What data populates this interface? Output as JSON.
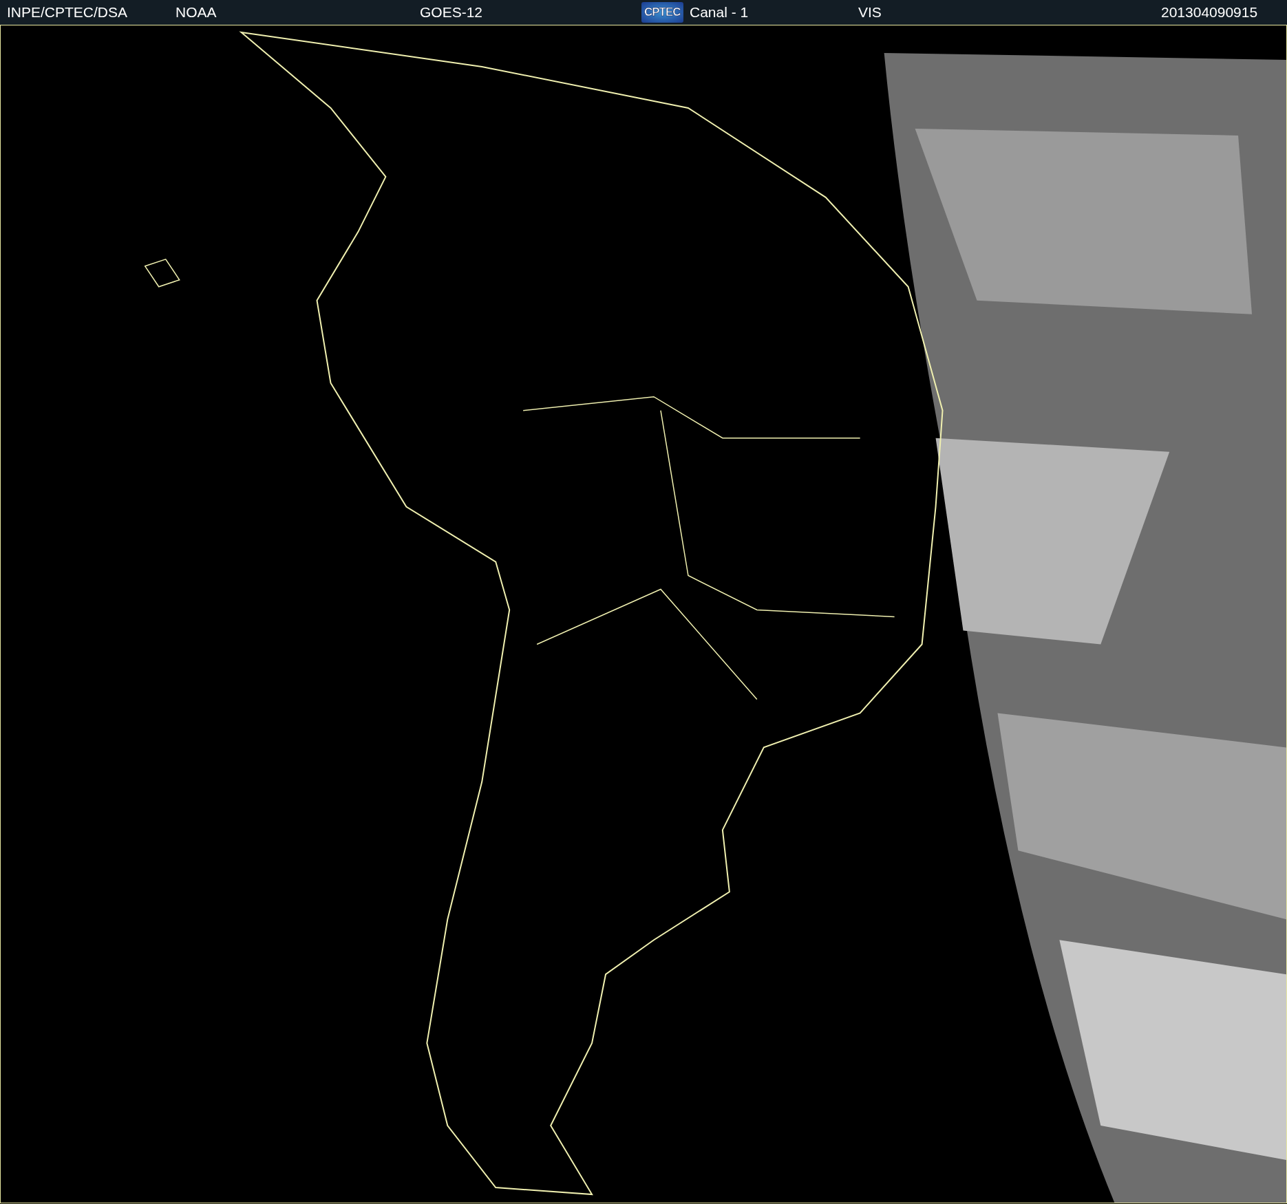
{
  "header": {
    "items": [
      {
        "kind": "text",
        "text": "INPE/CPTEC/DSA"
      },
      {
        "kind": "text",
        "text": "NOAA"
      },
      {
        "kind": "text",
        "text": "GOES-12"
      },
      {
        "kind": "logo",
        "text": "CPTEC"
      },
      {
        "kind": "text",
        "text": "Canal - 1"
      },
      {
        "kind": "text",
        "text": "VIS"
      },
      {
        "kind": "text",
        "text": "201304090915"
      }
    ]
  }
}
